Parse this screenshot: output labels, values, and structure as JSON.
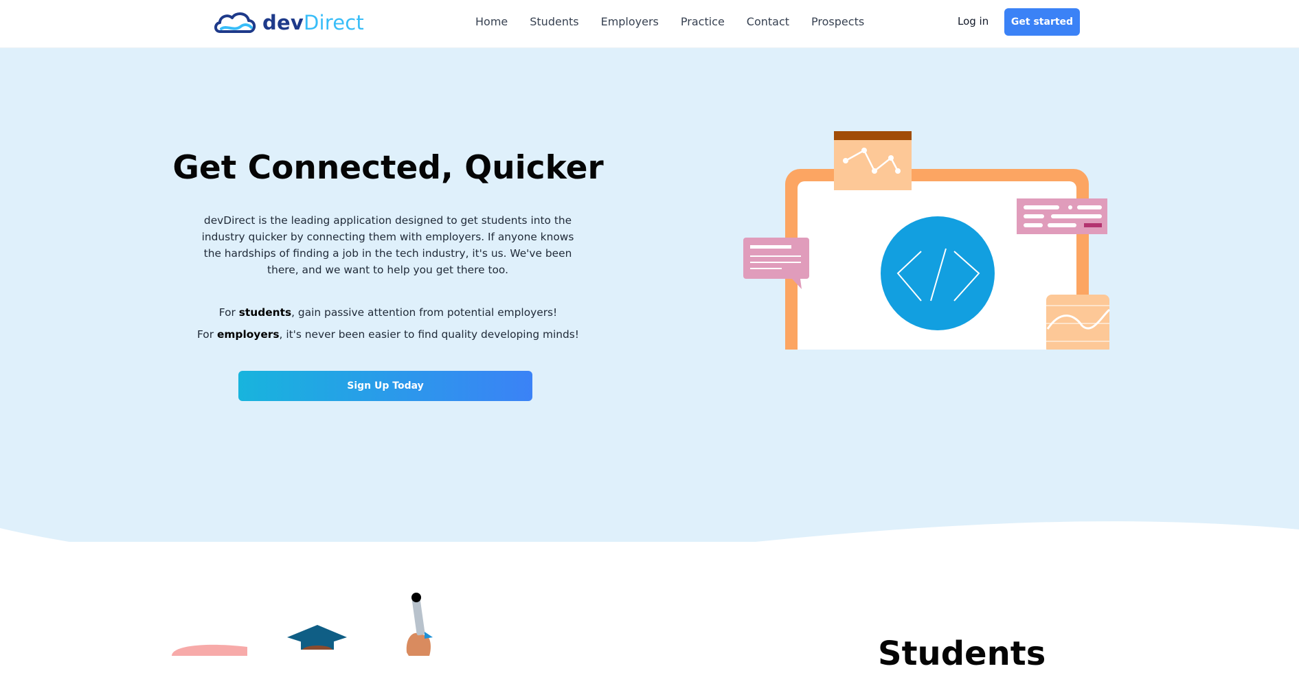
{
  "nav": {
    "logo": {
      "part1": "dev",
      "part2": "Direct"
    },
    "links": [
      "Home",
      "Students",
      "Employers",
      "Practice",
      "Contact",
      "Prospects"
    ],
    "login": "Log in",
    "cta": "Get started"
  },
  "hero": {
    "title": "Get Connected, Quicker",
    "description": "devDirect is the leading application designed to get students into the industry quicker by connecting them with employers. If anyone knows the hardships of finding a job in the tech industry, it's us. We've been there, and we want to help you get there too.",
    "line1": {
      "prefix": "For ",
      "bold": "students",
      "suffix": ", gain passive attention from potential employers!"
    },
    "line2": {
      "prefix": "For ",
      "bold": "employers",
      "suffix": ", it's never been easier to find quality developing minds!"
    },
    "button": "Sign Up Today"
  },
  "students_section": {
    "title": "Students"
  },
  "colors": {
    "hero_bg": "#dff0fb",
    "primary": "#3b82f6",
    "frame": "#fca562",
    "code_circle": "#129fe0"
  }
}
